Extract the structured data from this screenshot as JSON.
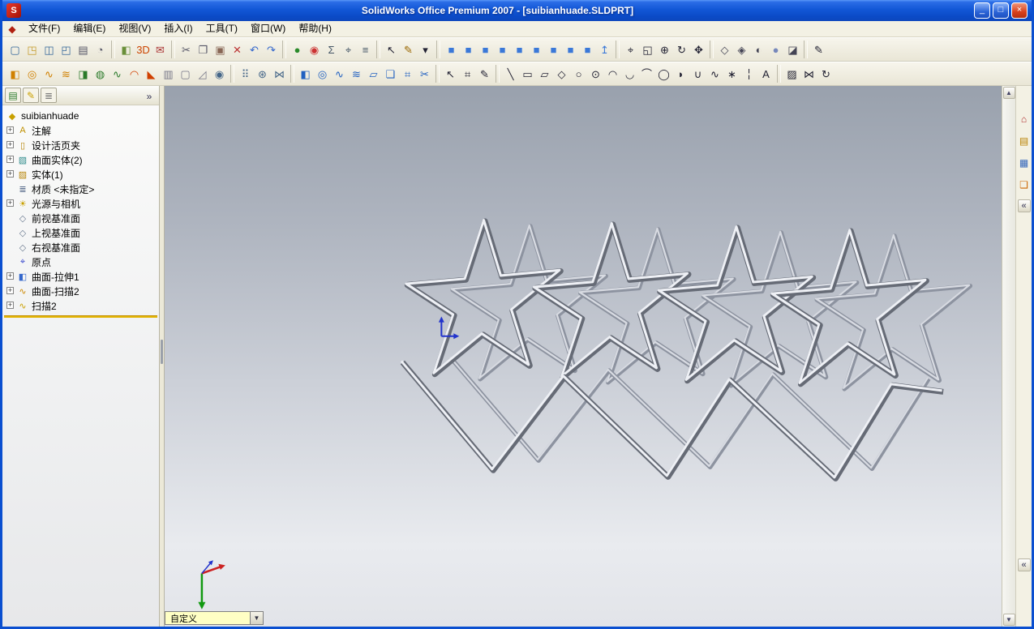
{
  "window": {
    "title": "SolidWorks Office Premium 2007 - [suibianhuade.SLDPRT]",
    "app_icon": "S",
    "controls": {
      "minimize": "_",
      "maximize": "□",
      "close": "×"
    }
  },
  "menubar": {
    "icon_glyph": "◆",
    "items": [
      {
        "name": "menu-file",
        "label": "文件(F)"
      },
      {
        "name": "menu-edit",
        "label": "编辑(E)"
      },
      {
        "name": "menu-view",
        "label": "视图(V)"
      },
      {
        "name": "menu-insert",
        "label": "插入(I)"
      },
      {
        "name": "menu-tools",
        "label": "工具(T)"
      },
      {
        "name": "menu-window",
        "label": "窗口(W)"
      },
      {
        "name": "menu-help",
        "label": "帮助(H)"
      }
    ]
  },
  "toolbars": {
    "row1": [
      {
        "name": "new-document",
        "glyph": "▢",
        "color": "#336699"
      },
      {
        "name": "open-document",
        "glyph": "◳",
        "color": "#c49a2a"
      },
      {
        "name": "save",
        "glyph": "◫",
        "color": "#336699"
      },
      {
        "name": "save-as",
        "glyph": "◰",
        "color": "#336699"
      },
      {
        "name": "print",
        "glyph": "▤",
        "color": "#555566"
      },
      {
        "name": "print-preview",
        "glyph": "◔",
        "color": "#555566"
      },
      {
        "name": "separator",
        "glyph": ""
      },
      {
        "name": "photoworks-render",
        "glyph": "◧",
        "color": "#6a8f3a"
      },
      {
        "name": "3d-instant-website",
        "glyph": "3D",
        "color": "#cc4400"
      },
      {
        "name": "edrawings",
        "glyph": "✉",
        "color": "#aa3333"
      },
      {
        "name": "separator",
        "glyph": ""
      },
      {
        "name": "cut",
        "glyph": "✂",
        "color": "#555566"
      },
      {
        "name": "copy",
        "glyph": "❐",
        "color": "#555566"
      },
      {
        "name": "paste",
        "glyph": "▣",
        "color": "#886655"
      },
      {
        "name": "delete",
        "glyph": "✕",
        "color": "#bb3333"
      },
      {
        "name": "undo",
        "glyph": "↶",
        "color": "#3366cc"
      },
      {
        "name": "redo",
        "glyph": "↷",
        "color": "#3366cc"
      },
      {
        "name": "separator",
        "glyph": ""
      },
      {
        "name": "rebuild",
        "glyph": "●",
        "color": "#2a8a2a"
      },
      {
        "name": "edit-color",
        "glyph": "◉",
        "color": "#cc3333"
      },
      {
        "name": "mass-properties",
        "glyph": "Σ",
        "color": "#445566"
      },
      {
        "name": "measure",
        "glyph": "⌖",
        "color": "#445566"
      },
      {
        "name": "document-properties",
        "glyph": "≡",
        "color": "#445566"
      },
      {
        "name": "separator",
        "glyph": ""
      },
      {
        "name": "select",
        "glyph": "↖",
        "color": "#222233"
      },
      {
        "name": "sketch-toggle",
        "glyph": "✎",
        "color": "#996600"
      },
      {
        "name": "standard-views-dropdown",
        "glyph": "▾",
        "color": "#222233"
      },
      {
        "name": "separator",
        "glyph": ""
      },
      {
        "name": "view-front",
        "glyph": "■",
        "color": "#3a78d8"
      },
      {
        "name": "view-back",
        "glyph": "■",
        "color": "#3a78d8"
      },
      {
        "name": "view-left",
        "glyph": "■",
        "color": "#3a78d8"
      },
      {
        "name": "view-right",
        "glyph": "■",
        "color": "#3a78d8"
      },
      {
        "name": "view-top",
        "glyph": "■",
        "color": "#3a78d8"
      },
      {
        "name": "view-bottom",
        "glyph": "■",
        "color": "#3a78d8"
      },
      {
        "name": "view-isometric",
        "glyph": "■",
        "color": "#3a78d8"
      },
      {
        "name": "view-trimetric",
        "glyph": "■",
        "color": "#3a78d8"
      },
      {
        "name": "view-dimetric",
        "glyph": "■",
        "color": "#3a78d8"
      },
      {
        "name": "view-normal-to",
        "glyph": "↥",
        "color": "#3a78d8"
      },
      {
        "name": "separator",
        "glyph": ""
      },
      {
        "name": "zoom-to-fit",
        "glyph": "⌖",
        "color": "#222233"
      },
      {
        "name": "zoom-to-area",
        "glyph": "◱",
        "color": "#222233"
      },
      {
        "name": "zoom-in-out",
        "glyph": "⊕",
        "color": "#222233"
      },
      {
        "name": "rotate-view",
        "glyph": "↻",
        "color": "#222233"
      },
      {
        "name": "pan",
        "glyph": "✥",
        "color": "#222233"
      },
      {
        "name": "separator",
        "glyph": ""
      },
      {
        "name": "wireframe",
        "glyph": "◇",
        "color": "#444455"
      },
      {
        "name": "hidden-lines-visible",
        "glyph": "◈",
        "color": "#444455"
      },
      {
        "name": "shaded-with-edges",
        "glyph": "◐",
        "color": "#444455"
      },
      {
        "name": "shaded",
        "glyph": "●",
        "color": "#7788bb"
      },
      {
        "name": "section-view",
        "glyph": "◪",
        "color": "#444455"
      },
      {
        "name": "separator",
        "glyph": ""
      },
      {
        "name": "toolbar-pen",
        "glyph": "✎",
        "color": "#222233"
      }
    ],
    "row2": [
      {
        "name": "extruded-boss",
        "glyph": "◧",
        "color": "#d08000"
      },
      {
        "name": "revolved-boss",
        "glyph": "◎",
        "color": "#d08000"
      },
      {
        "name": "swept-boss",
        "glyph": "∿",
        "color": "#d08000"
      },
      {
        "name": "lofted-boss",
        "glyph": "≋",
        "color": "#d08000"
      },
      {
        "name": "extruded-cut",
        "glyph": "◨",
        "color": "#2a7a2a"
      },
      {
        "name": "revolved-cut",
        "glyph": "◍",
        "color": "#2a7a2a"
      },
      {
        "name": "swept-cut",
        "glyph": "∿",
        "color": "#2a7a2a"
      },
      {
        "name": "fillet",
        "glyph": "◠",
        "color": "#d04000"
      },
      {
        "name": "chamfer",
        "glyph": "◣",
        "color": "#d04000"
      },
      {
        "name": "rib",
        "glyph": "▥",
        "color": "#777788"
      },
      {
        "name": "shell",
        "glyph": "▢",
        "color": "#777788"
      },
      {
        "name": "draft",
        "glyph": "◿",
        "color": "#777788"
      },
      {
        "name": "hole-wizard",
        "glyph": "◉",
        "color": "#446688"
      },
      {
        "name": "separator",
        "glyph": ""
      },
      {
        "name": "linear-pattern",
        "glyph": "⠿",
        "color": "#446688"
      },
      {
        "name": "circular-pattern",
        "glyph": "⊛",
        "color": "#446688"
      },
      {
        "name": "mirror-feature",
        "glyph": "⋈",
        "color": "#446688"
      },
      {
        "name": "separator",
        "glyph": ""
      },
      {
        "name": "surface-extrude",
        "glyph": "◧",
        "color": "#2060c0"
      },
      {
        "name": "surface-revolve",
        "glyph": "◎",
        "color": "#2060c0"
      },
      {
        "name": "surface-sweep",
        "glyph": "∿",
        "color": "#2060c0"
      },
      {
        "name": "surface-loft",
        "glyph": "≋",
        "color": "#2060c0"
      },
      {
        "name": "planar-surface",
        "glyph": "▱",
        "color": "#2060c0"
      },
      {
        "name": "offset-surface",
        "glyph": "❏",
        "color": "#2060c0"
      },
      {
        "name": "knit-surface",
        "glyph": "⌗",
        "color": "#2060c0"
      },
      {
        "name": "trim-surface",
        "glyph": "✂",
        "color": "#2060c0"
      },
      {
        "name": "separator",
        "glyph": ""
      },
      {
        "name": "select-tool",
        "glyph": "↖",
        "color": "#222233"
      },
      {
        "name": "sketch-grid",
        "glyph": "⌗",
        "color": "#222233"
      },
      {
        "name": "sketch-entity",
        "glyph": "✎",
        "color": "#222233"
      },
      {
        "name": "separator",
        "glyph": ""
      },
      {
        "name": "line-tool",
        "glyph": "╲",
        "color": "#222233"
      },
      {
        "name": "rectangle-tool",
        "glyph": "▭",
        "color": "#222233"
      },
      {
        "name": "parallelogram-tool",
        "glyph": "▱",
        "color": "#222233"
      },
      {
        "name": "polygon-tool",
        "glyph": "◇",
        "color": "#222233"
      },
      {
        "name": "circle-tool",
        "glyph": "○",
        "color": "#222233"
      },
      {
        "name": "perimeter-circle-tool",
        "glyph": "⊙",
        "color": "#222233"
      },
      {
        "name": "centerpoint-arc-tool",
        "glyph": "◠",
        "color": "#222233"
      },
      {
        "name": "tangent-arc-tool",
        "glyph": "◡",
        "color": "#222233"
      },
      {
        "name": "three-point-arc-tool",
        "glyph": "⌒",
        "color": "#222233"
      },
      {
        "name": "ellipse-tool",
        "glyph": "◯",
        "color": "#222233"
      },
      {
        "name": "partial-ellipse-tool",
        "glyph": "◗",
        "color": "#222233"
      },
      {
        "name": "parabola-tool",
        "glyph": "∪",
        "color": "#222233"
      },
      {
        "name": "spline-tool",
        "glyph": "∿",
        "color": "#222233"
      },
      {
        "name": "point-tool",
        "glyph": "∗",
        "color": "#222233"
      },
      {
        "name": "centerline-tool",
        "glyph": "╎",
        "color": "#222233"
      },
      {
        "name": "text-tool",
        "glyph": "A",
        "color": "#222233"
      },
      {
        "name": "separator",
        "glyph": ""
      },
      {
        "name": "crosshatch",
        "glyph": "▨",
        "color": "#222233"
      },
      {
        "name": "mirror-entities",
        "glyph": "⋈",
        "color": "#222233"
      },
      {
        "name": "rotate-entities",
        "glyph": "↻",
        "color": "#222233"
      }
    ]
  },
  "panel": {
    "tabs": [
      {
        "name": "featuremanager-tab",
        "glyph": "▤",
        "color": "#2a7a2a"
      },
      {
        "name": "propertymanager-tab",
        "glyph": "✎",
        "color": "#caa000"
      },
      {
        "name": "configurationmanager-tab",
        "glyph": "≣",
        "color": "#7a7a7a"
      }
    ],
    "expand_label": "»"
  },
  "tree": {
    "root": {
      "label": "suibianhuade",
      "glyph": "◆",
      "color": "#c8a000"
    },
    "items": [
      {
        "name": "tree-item-annotations",
        "plus": "+",
        "glyph": "A",
        "color": "#c09000",
        "label": "注解"
      },
      {
        "name": "tree-item-design-binder",
        "plus": "+",
        "glyph": "▯",
        "color": "#b8860b",
        "label": "设计活页夹"
      },
      {
        "name": "tree-item-surface-bodies",
        "plus": "+",
        "glyph": "▧",
        "color": "#2e8b8b",
        "label": "曲面实体(2)"
      },
      {
        "name": "tree-item-solid-bodies",
        "plus": "+",
        "glyph": "▨",
        "color": "#b8860b",
        "label": "实体(1)"
      },
      {
        "name": "tree-item-material",
        "plus": "",
        "glyph": "≣",
        "color": "#566a8a",
        "label": "材质 <未指定>"
      },
      {
        "name": "tree-item-lights-cameras",
        "plus": "+",
        "glyph": "☀",
        "color": "#c8a000",
        "label": "光源与相机"
      },
      {
        "name": "tree-item-front-plane",
        "plus": "",
        "glyph": "◇",
        "color": "#6a7a90",
        "label": "前视基准面"
      },
      {
        "name": "tree-item-top-plane",
        "plus": "",
        "glyph": "◇",
        "color": "#6a7a90",
        "label": "上视基准面"
      },
      {
        "name": "tree-item-right-plane",
        "plus": "",
        "glyph": "◇",
        "color": "#6a7a90",
        "label": "右视基准面"
      },
      {
        "name": "tree-item-origin",
        "plus": "",
        "glyph": "⌖",
        "color": "#3344cc",
        "label": "原点"
      },
      {
        "name": "tree-item-surface-extrude1",
        "plus": "+",
        "glyph": "◧",
        "color": "#3366cc",
        "label": "曲面-拉伸1"
      },
      {
        "name": "tree-item-surface-sweep2",
        "plus": "+",
        "glyph": "∿",
        "color": "#cc8800",
        "label": "曲面-扫描2"
      },
      {
        "name": "tree-item-sweep2",
        "plus": "+",
        "glyph": "∿",
        "color": "#caa000",
        "label": "扫描2"
      }
    ]
  },
  "viewport": {
    "combo": {
      "value": "自定义",
      "arrow": "▼"
    },
    "scroll_up": "▲",
    "scroll_down": "▼"
  },
  "taskpane": {
    "icons": [
      {
        "name": "solidworks-resources",
        "glyph": "⌂",
        "color": "#b03030"
      },
      {
        "name": "design-library",
        "glyph": "▤",
        "color": "#b88000"
      },
      {
        "name": "file-explorer",
        "glyph": "▦",
        "color": "#3366bb"
      },
      {
        "name": "view-palette",
        "glyph": "❏",
        "color": "#cc6600"
      }
    ],
    "collapse": "«"
  }
}
